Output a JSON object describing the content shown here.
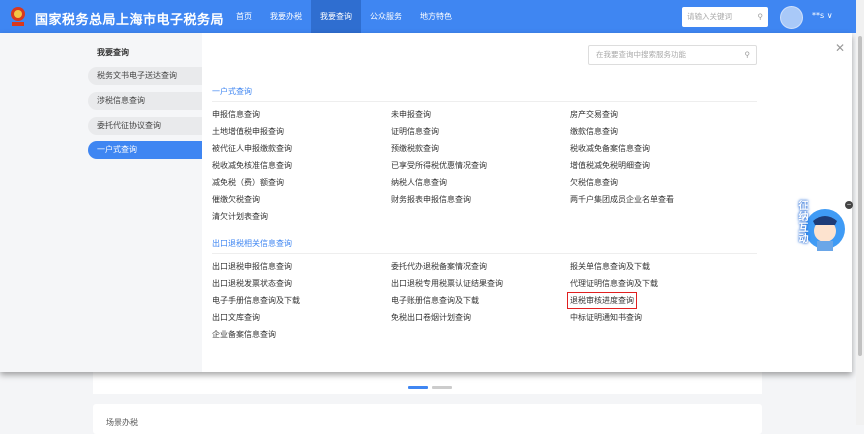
{
  "header": {
    "site_title": "国家税务总局上海市电子税务局",
    "nav": [
      "首页",
      "我要办税",
      "我要查询",
      "公众服务",
      "地方特色"
    ],
    "active_nav": "我要查询",
    "search_placeholder": "请输入关键词",
    "user_name": "**s ∨"
  },
  "sidebar": {
    "title": "我要查询",
    "items": [
      "税务文书电子送达查询",
      "涉税信息查询",
      "委托代征协议查询",
      "一户式查询"
    ],
    "active": "一户式查询"
  },
  "panel": {
    "search_placeholder": "在我要查询中搜索服务功能",
    "sections": [
      {
        "title": "一户式查询",
        "links": [
          "申报信息查询",
          "未申报查询",
          "房产交易查询",
          "土地增值税申报查询",
          "证明信息查询",
          "缴款信息查询",
          "被代征人申报缴款查询",
          "预缴税款查询",
          "税收减免备案信息查询",
          "税收减免核准信息查询",
          "已享受所得税优惠情况查询",
          "增值税减免税明细查询",
          "减免税（费）额查询",
          "纳税人信息查询",
          "欠税信息查询",
          "催缴欠税查询",
          "财务报表申报信息查询",
          "两千户集团成员企业名单查看",
          "清欠计划表查询"
        ]
      },
      {
        "title": "出口退税相关信息查询",
        "links": [
          "出口退税申报信息查询",
          "委托代办退税备案情况查询",
          "报关单信息查询及下载",
          "出口退税发票状态查询",
          "出口退税专用税票认证结果查询",
          "代理证明信息查询及下载",
          "电子手册信息查询及下载",
          "电子账册信息查询及下载",
          "退税审核进度查询",
          "出口文库查询",
          "免税出口卷烟计划查询",
          "中标证明通知书查询",
          "企业备案信息查询"
        ]
      }
    ],
    "highlighted_link": "退税审核进度查询"
  },
  "mascot": {
    "text": "征纳互动"
  },
  "bottom": {
    "card_title": "场景办税",
    "carousel_pages": 2,
    "carousel_active": 1
  },
  "colors": {
    "brand": "#3f86f2",
    "highlight": "#e02020"
  }
}
